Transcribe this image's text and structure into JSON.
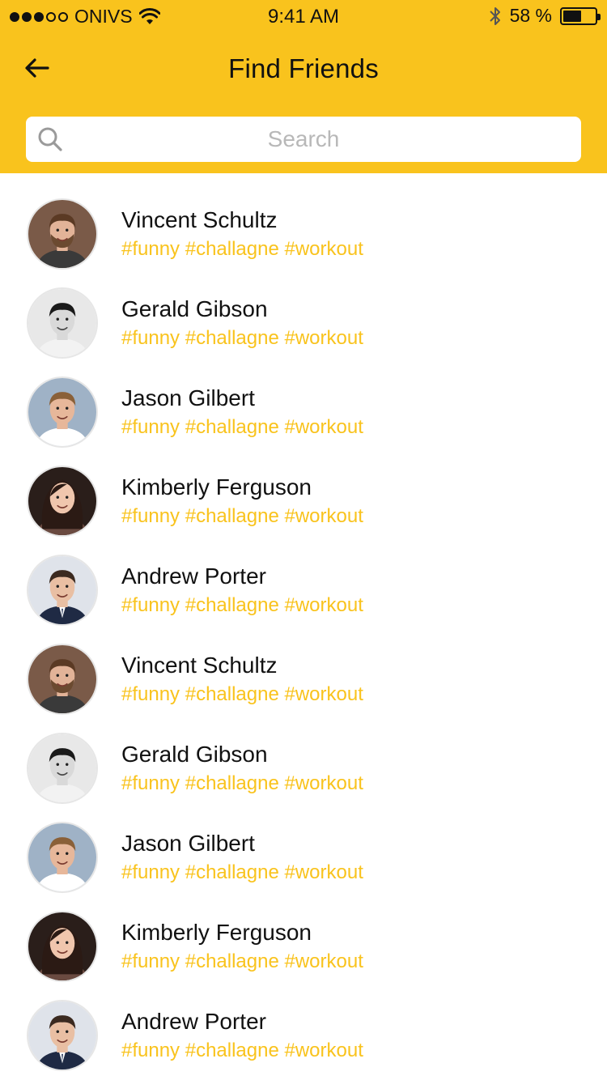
{
  "status_bar": {
    "carrier": "ONIVS",
    "time": "9:41 AM",
    "battery_text": "58 %",
    "battery_level": 0.58,
    "signal_bars_filled": 3,
    "signal_bars_total": 5
  },
  "header": {
    "title": "Find Friends",
    "back_icon": "arrow-left-icon",
    "background_color": "#f9c31d"
  },
  "search": {
    "placeholder": "Search",
    "value": "",
    "icon": "search-icon"
  },
  "accent_color": "#f9c31d",
  "friends": [
    {
      "name": "Vincent Schultz",
      "tags": "#funny #challagne #workout",
      "avatar": "vincent"
    },
    {
      "name": "Gerald Gibson",
      "tags": "#funny #challagne #workout",
      "avatar": "gerald"
    },
    {
      "name": "Jason Gilbert",
      "tags": "#funny #challagne #workout",
      "avatar": "jason"
    },
    {
      "name": "Kimberly Ferguson",
      "tags": "#funny #challagne #workout",
      "avatar": "kimberly"
    },
    {
      "name": "Andrew Porter",
      "tags": "#funny #challagne #workout",
      "avatar": "andrew"
    },
    {
      "name": "Vincent Schultz",
      "tags": "#funny #challagne #workout",
      "avatar": "vincent"
    },
    {
      "name": "Gerald Gibson",
      "tags": "#funny #challagne #workout",
      "avatar": "gerald"
    },
    {
      "name": "Jason Gilbert",
      "tags": "#funny #challagne #workout",
      "avatar": "jason"
    },
    {
      "name": "Kimberly Ferguson",
      "tags": "#funny #challagne #workout",
      "avatar": "kimberly"
    },
    {
      "name": "Andrew Porter",
      "tags": "#funny #challagne #workout",
      "avatar": "andrew"
    }
  ]
}
